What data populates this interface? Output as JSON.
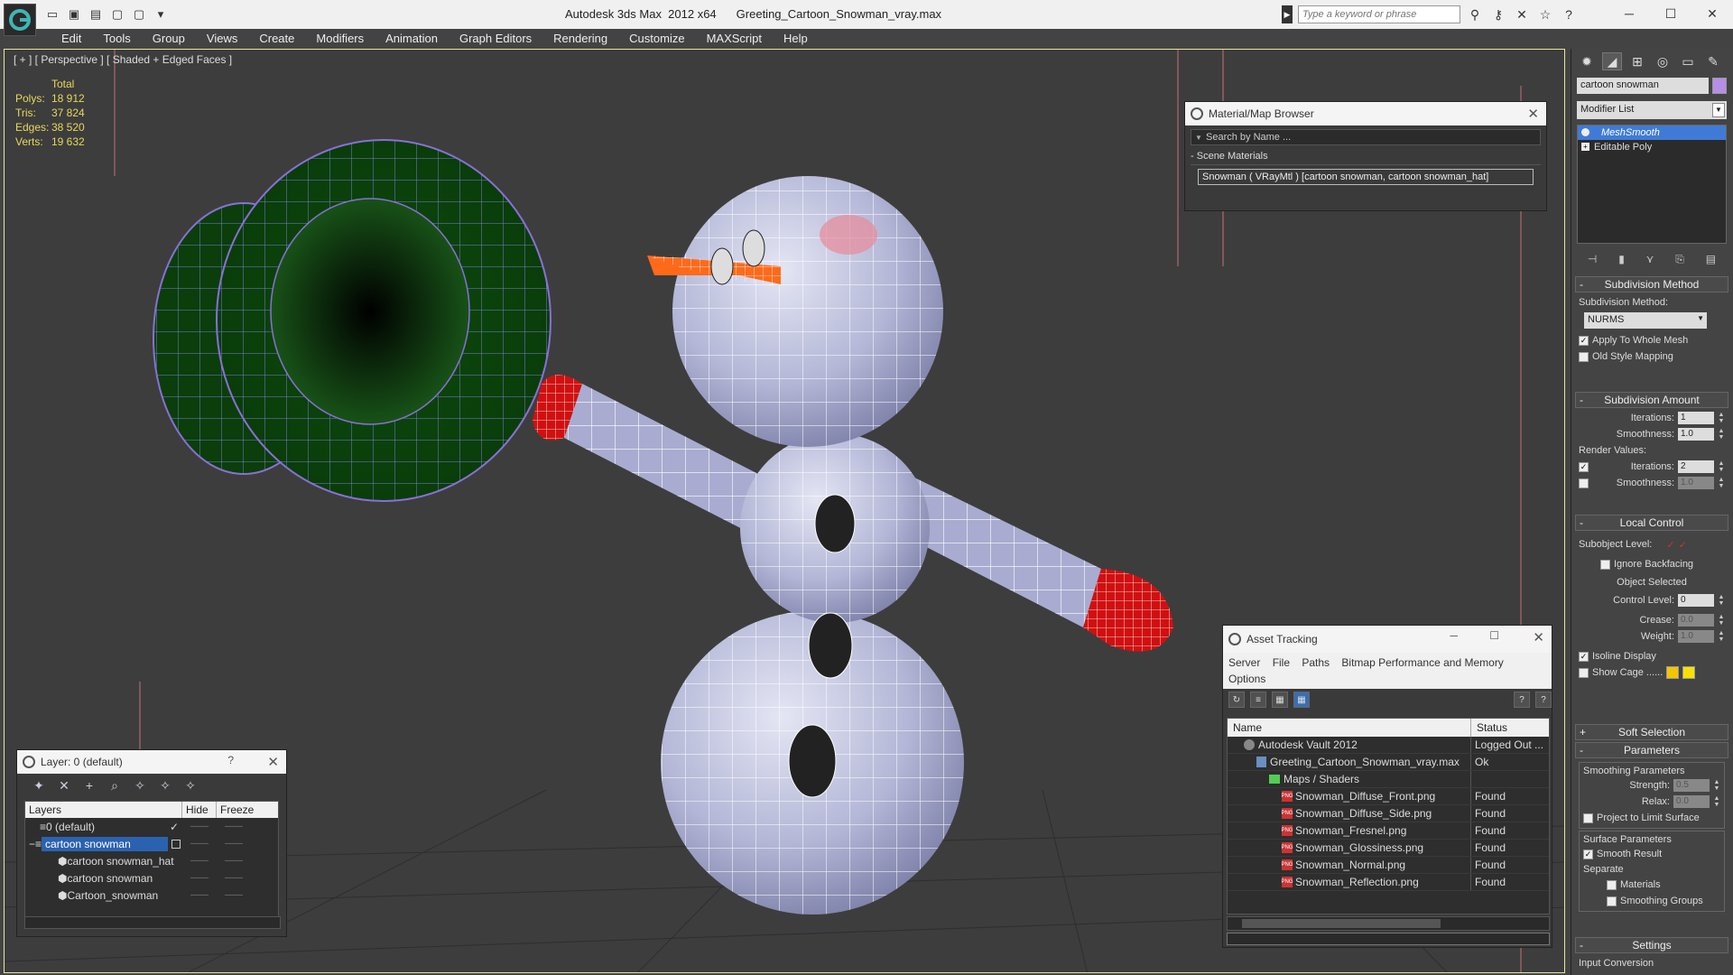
{
  "window": {
    "app_title": "Autodesk 3ds Max  2012 x64",
    "file_title": "Greeting_Cartoon_Snowman_vray.max",
    "search_placeholder": "Type a keyword or phrase",
    "minimize": "─",
    "maximize": "☐",
    "close": "✕"
  },
  "menu": [
    "Edit",
    "Tools",
    "Group",
    "Views",
    "Create",
    "Modifiers",
    "Animation",
    "Graph Editors",
    "Rendering",
    "Customize",
    "MAXScript",
    "Help"
  ],
  "viewport": {
    "label": "[ + ] [ Perspective ] [ Shaded + Edged Faces ]",
    "stats": {
      "header": "Total",
      "rows": [
        {
          "k": "Polys:",
          "v": "18 912"
        },
        {
          "k": "Tris:",
          "v": "37 824"
        },
        {
          "k": "Edges:",
          "v": "38 520"
        },
        {
          "k": "Verts:",
          "v": "19 632"
        }
      ]
    }
  },
  "material_browser": {
    "title": "Material/Map Browser",
    "search": "Search by Name ...",
    "section": "Scene Materials",
    "item": "Snowman  ( VRayMtl )  [cartoon snowman, cartoon snowman_hat]"
  },
  "asset_tracking": {
    "title": "Asset Tracking",
    "menu": [
      "Server",
      "File",
      "Paths",
      "Bitmap Performance and Memory",
      "Options"
    ],
    "columns": [
      "Name",
      "Status"
    ],
    "rows": [
      {
        "name": "Autodesk Vault 2012",
        "status": "Logged Out ...",
        "indent": 1,
        "icon": "vault"
      },
      {
        "name": "Greeting_Cartoon_Snowman_vray.max",
        "status": "Ok",
        "indent": 2,
        "icon": "file"
      },
      {
        "name": "Maps / Shaders",
        "status": "",
        "indent": 3,
        "icon": "folder"
      },
      {
        "name": "Snowman_Diffuse_Front.png",
        "status": "Found",
        "indent": 4,
        "icon": "png"
      },
      {
        "name": "Snowman_Diffuse_Side.png",
        "status": "Found",
        "indent": 4,
        "icon": "png"
      },
      {
        "name": "Snowman_Fresnel.png",
        "status": "Found",
        "indent": 4,
        "icon": "png"
      },
      {
        "name": "Snowman_Glossiness.png",
        "status": "Found",
        "indent": 4,
        "icon": "png"
      },
      {
        "name": "Snowman_Normal.png",
        "status": "Found",
        "indent": 4,
        "icon": "png"
      },
      {
        "name": "Snowman_Reflection.png",
        "status": "Found",
        "indent": 4,
        "icon": "png"
      }
    ]
  },
  "layers": {
    "title": "Layer: 0 (default)",
    "help": "?",
    "columns": [
      "Layers",
      "Hide",
      "Freeze"
    ],
    "rows": [
      {
        "name": "0 (default)",
        "indent": 1,
        "selected": false,
        "check": "✓"
      },
      {
        "name": "cartoon snowman",
        "indent": 1,
        "selected": true,
        "check": ""
      },
      {
        "name": "cartoon snowman_hat",
        "indent": 2,
        "selected": false,
        "check": ""
      },
      {
        "name": "cartoon snowman",
        "indent": 2,
        "selected": false,
        "check": ""
      },
      {
        "name": "Cartoon_snowman",
        "indent": 2,
        "selected": false,
        "check": ""
      }
    ],
    "hide_mark": "——",
    "freeze_mark": "——"
  },
  "command_panel": {
    "object_name": "cartoon snowman",
    "object_color": "#b68ee8",
    "modifier_list": "Modifier List",
    "stack": [
      "MeshSmooth",
      "Editable Poly"
    ],
    "subdivision_method": {
      "header": "Subdivision Method",
      "label": "Subdivision Method:",
      "value": "NURMS",
      "apply_whole_mesh": "Apply To Whole Mesh",
      "old_style_mapping": "Old Style Mapping"
    },
    "subdivision_amount": {
      "header": "Subdivision Amount",
      "iterations_label": "Iterations:",
      "iterations": "1",
      "smoothness_label": "Smoothness:",
      "smoothness": "1.0",
      "render_values": "Render Values:",
      "render_iterations_label": "Iterations:",
      "render_iterations": "2",
      "render_smoothness_label": "Smoothness:",
      "render_smoothness": "1.0"
    },
    "local_control": {
      "header": "Local Control",
      "subobject_level": "Subobject Level:",
      "ignore_backfacing": "Ignore Backfacing",
      "object_selected": "Object Selected",
      "control_level_label": "Control Level:",
      "control_level": "0",
      "crease_label": "Crease:",
      "crease": "0.0",
      "weight_label": "Weight:",
      "weight": "1.0",
      "isoline_display": "Isoline Display",
      "show_cage": "Show Cage ......"
    },
    "soft_selection": {
      "header": "Soft Selection"
    },
    "parameters": {
      "header": "Parameters",
      "smoothing_params": "Smoothing Parameters",
      "strength_label": "Strength:",
      "strength": "0.5",
      "relax_label": "Relax:",
      "relax": "0.0",
      "project_limit": "Project to Limit Surface",
      "surface_params": "Surface Parameters",
      "smooth_result": "Smooth Result",
      "separate": "Separate",
      "materials": "Materials",
      "smoothing_groups": "Smoothing Groups"
    },
    "settings": {
      "header": "Settings",
      "input_conversion": "Input Conversion"
    }
  }
}
